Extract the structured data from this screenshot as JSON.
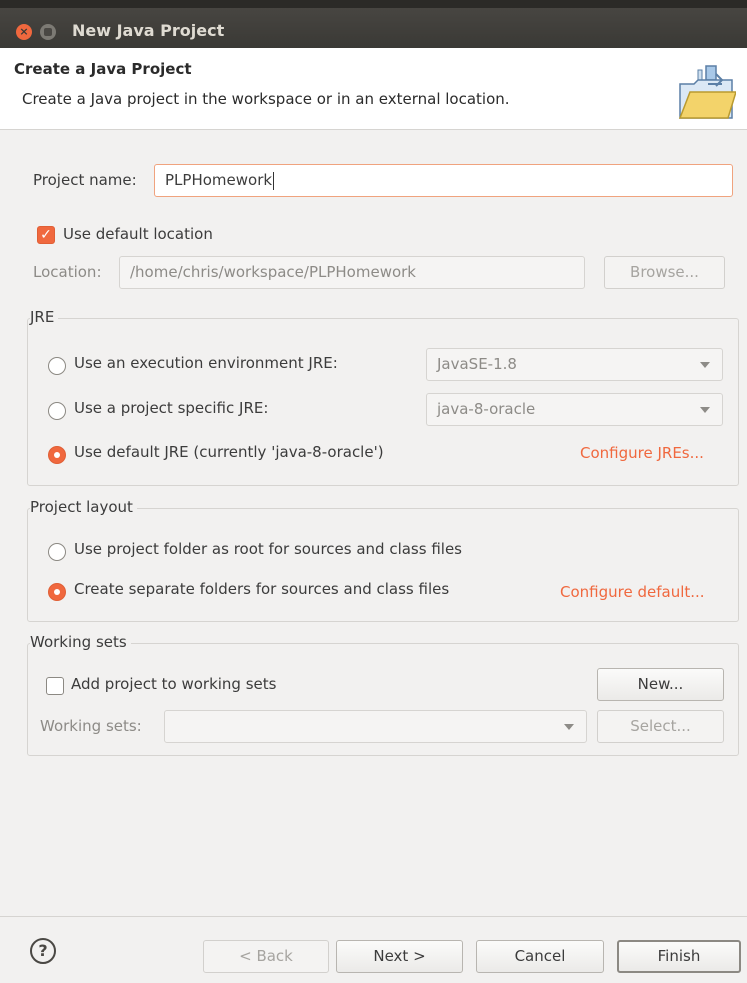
{
  "window": {
    "title": "New Java Project"
  },
  "header": {
    "title": "Create a Java Project",
    "description": "Create a Java project in the workspace or in an external location."
  },
  "project": {
    "name_label": "Project name:",
    "name_value": "PLPHomework",
    "use_default_location_label": "Use default location",
    "use_default_location_checked": true,
    "location_label": "Location:",
    "location_value": "/home/chris/workspace/PLPHomework",
    "browse_label": "Browse..."
  },
  "jre": {
    "legend": "JRE",
    "options": [
      {
        "label": "Use an execution environment JRE:",
        "checked": false,
        "combo_value": "JavaSE-1.8"
      },
      {
        "label": "Use a project specific JRE:",
        "checked": false,
        "combo_value": "java-8-oracle"
      },
      {
        "label": "Use default JRE (currently 'java-8-oracle')",
        "checked": true
      }
    ],
    "configure_link": "Configure JREs..."
  },
  "layout": {
    "legend": "Project layout",
    "options": [
      {
        "label": "Use project folder as root for sources and class files",
        "checked": false
      },
      {
        "label": "Create separate folders for sources and class files",
        "checked": true
      }
    ],
    "configure_link": "Configure default..."
  },
  "working_sets": {
    "legend": "Working sets",
    "add_label": "Add project to working sets",
    "add_checked": false,
    "new_label": "New...",
    "sets_label": "Working sets:",
    "sets_value": "",
    "select_label": "Select..."
  },
  "footer": {
    "help_glyph": "?",
    "back_label": "< Back",
    "next_label": "Next >",
    "cancel_label": "Cancel",
    "finish_label": "Finish"
  },
  "colors": {
    "accent": "#f0683e",
    "titlebar": "#3a3935"
  }
}
